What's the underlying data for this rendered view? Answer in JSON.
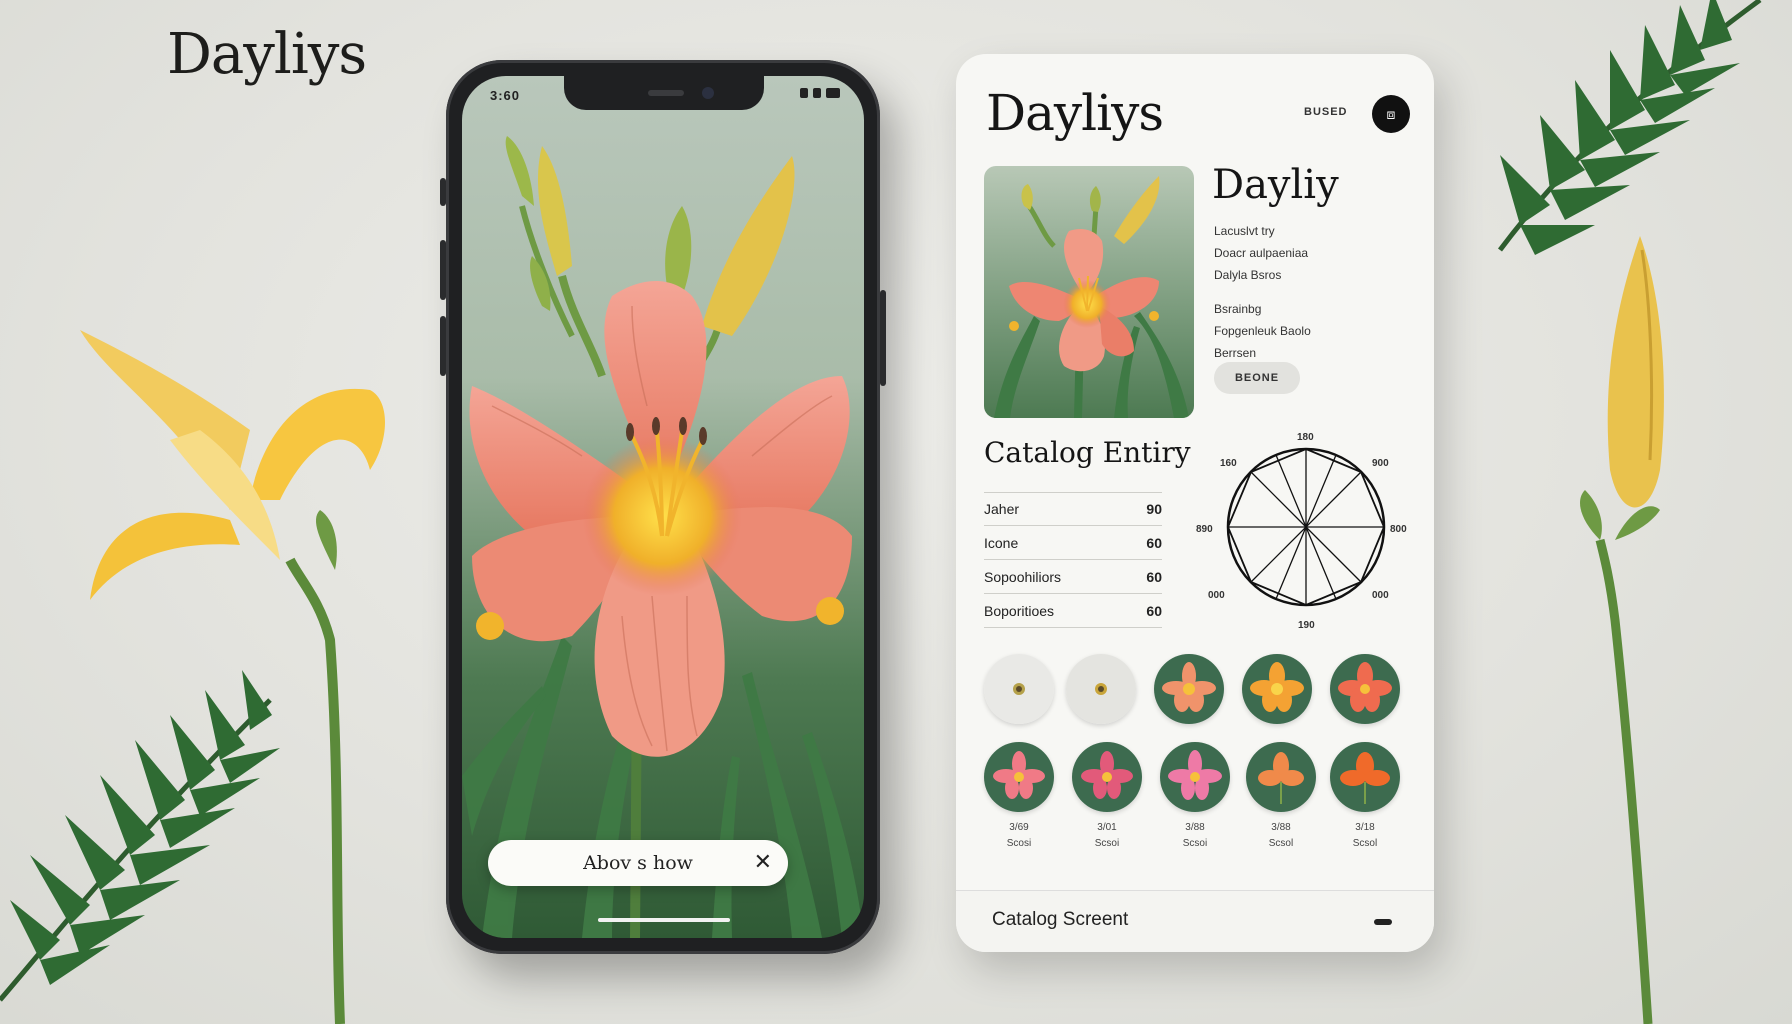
{
  "brand": "Dayliys",
  "phone": {
    "status_time": "3:60",
    "banner_text": "Abov s how",
    "banner_close_icon": "close-icon"
  },
  "catalog": {
    "title": "Dayliys",
    "header_small": "BUSED",
    "header_button_icon": "menu-icon",
    "detail": {
      "title": "Dayliy",
      "lines": [
        "Lacuslvt try",
        "Doacr aulpaeniaa",
        "Dalyla Bsros",
        "Bsrainbg",
        "Fopgenleuk Baolo",
        "Berrsen"
      ],
      "button": "BEONE"
    },
    "section_title": "Catalog Entiry",
    "rows": [
      {
        "label": "Jaher",
        "value": "90"
      },
      {
        "label": "Icone",
        "value": "60"
      },
      {
        "label": "Sopoohiliors",
        "value": "60"
      },
      {
        "label": "Boporitioes",
        "value": "60"
      }
    ],
    "radar": {
      "top": "180",
      "top_left": "160",
      "top_right": "900",
      "left": "890",
      "right": "800",
      "bottom_left": "000",
      "bottom_right": "000",
      "bottom": "190"
    },
    "gallery_row1_colors": [
      "#e9e9e6",
      "#e4e4e0",
      "#f0936b",
      "#f4a233",
      "#ef6b4f"
    ],
    "gallery_row2_colors": [
      "#f07a86",
      "#e25a7a",
      "#ee7aa6",
      "#f08a4a",
      "#f06a2a"
    ],
    "gallery_labels": [
      [
        "3/69",
        "Scosi"
      ],
      [
        "3/01",
        "Scsoi"
      ],
      [
        "3/88",
        "Scsoi"
      ],
      [
        "3/88",
        "Scsol"
      ],
      [
        "3/18",
        "Scsol"
      ]
    ],
    "footer_label": "Catalog Screent"
  }
}
